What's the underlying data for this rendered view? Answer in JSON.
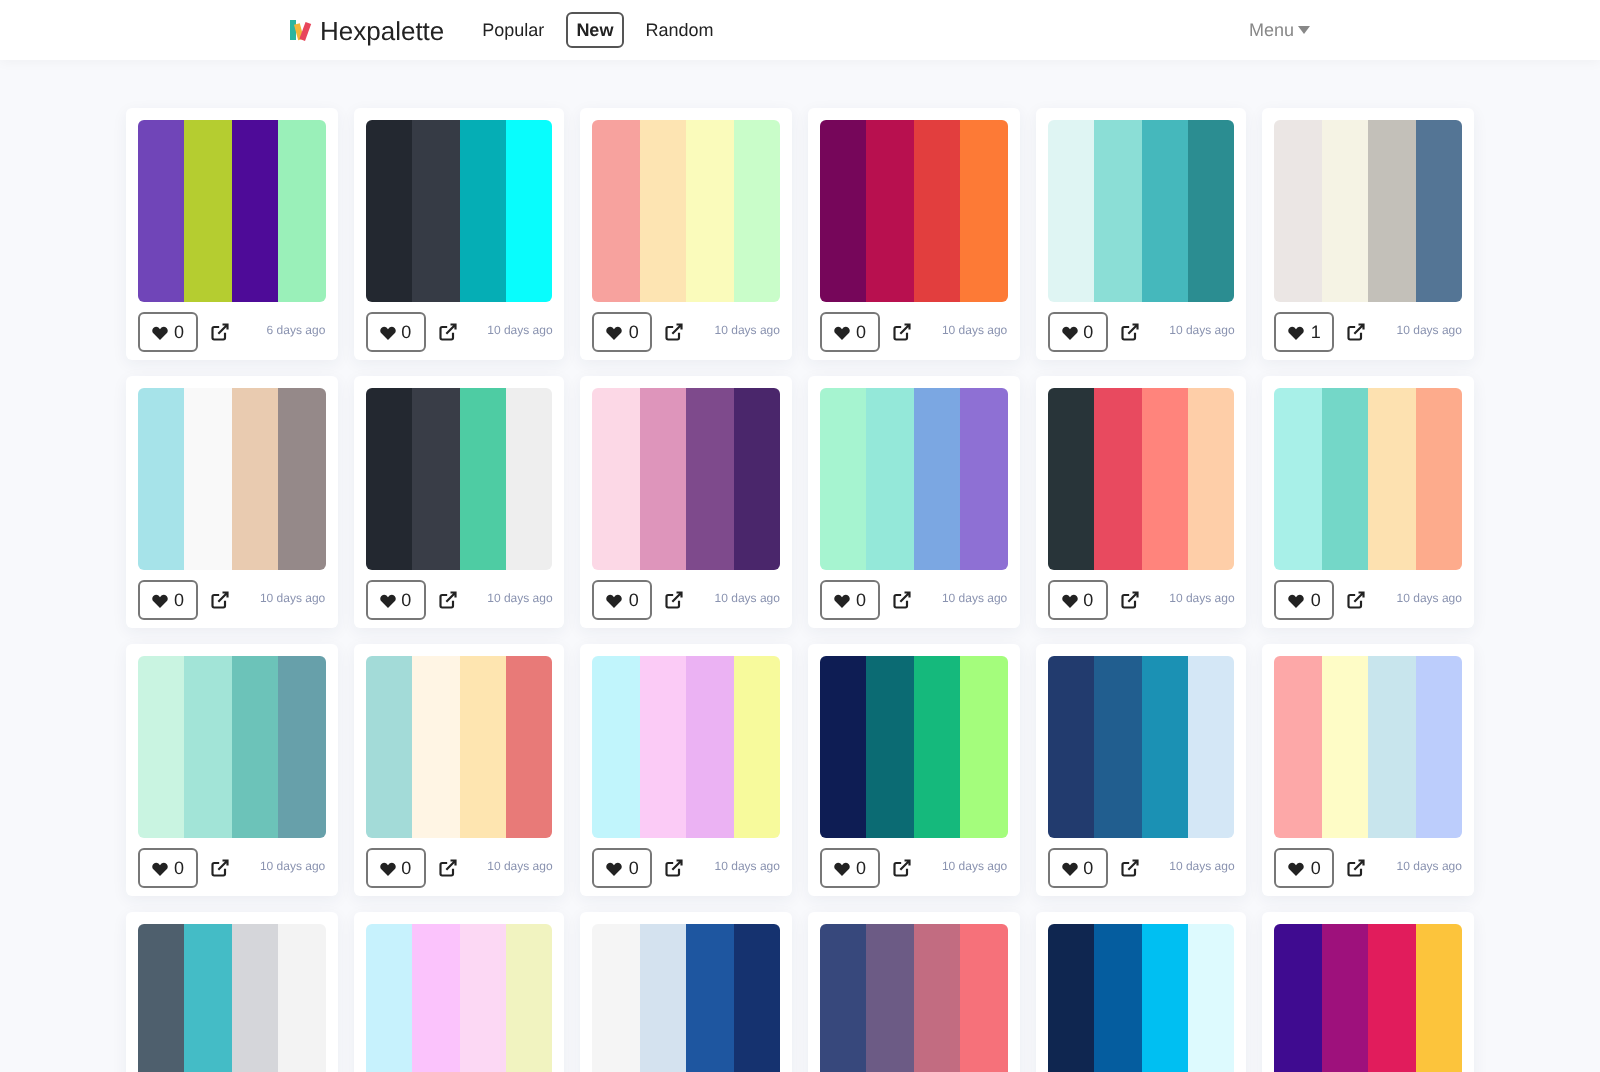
{
  "navbar": {
    "brand": "Hexpalette",
    "links": [
      {
        "label": "Popular",
        "selected": false
      },
      {
        "label": "New",
        "selected": true
      },
      {
        "label": "Random",
        "selected": false
      }
    ],
    "menu": "Menu"
  },
  "palettes": [
    {
      "stripes": [
        {
          "color": "#7045b8"
        },
        {
          "color": "#b5cd30"
        },
        {
          "color": "#4e0b98"
        },
        {
          "color": "#9af0b9"
        }
      ],
      "likes": "0",
      "age": "6 days ago"
    },
    {
      "stripes": [
        {
          "color": "#232830"
        },
        {
          "color": "#363b45"
        },
        {
          "color": "#05aeb5"
        },
        {
          "color": "#08fdfd"
        }
      ],
      "likes": "0",
      "age": "10 days ago"
    },
    {
      "stripes": [
        {
          "color": "#f7a29e"
        },
        {
          "color": "#fde4b2"
        },
        {
          "color": "#fafbbb"
        },
        {
          "color": "#c9fdc9"
        }
      ],
      "likes": "0",
      "age": "10 days ago"
    },
    {
      "stripes": [
        {
          "color": "#76065a"
        },
        {
          "color": "#b8104f"
        },
        {
          "color": "#e23e3e"
        },
        {
          "color": "#fd7a36"
        }
      ],
      "likes": "0",
      "age": "10 days ago"
    },
    {
      "stripes": [
        {
          "color": "#dff5f3"
        },
        {
          "color": "#8bded6"
        },
        {
          "color": "#45b8bc"
        },
        {
          "color": "#2b8d91"
        }
      ],
      "likes": "0",
      "age": "10 days ago"
    },
    {
      "stripes": [
        {
          "color": "#ebe6e4"
        },
        {
          "color": "#f5f3e4"
        },
        {
          "color": "#c3c0b9"
        },
        {
          "color": "#547595"
        }
      ],
      "likes": "1",
      "age": "10 days ago"
    },
    {
      "stripes": [
        {
          "color": "#a6e3e9"
        },
        {
          "color": "#f9f9f9"
        },
        {
          "color": "#e9cbb0"
        },
        {
          "color": "#958989"
        }
      ],
      "likes": "0",
      "age": "10 days ago"
    },
    {
      "stripes": [
        {
          "color": "#232830"
        },
        {
          "color": "#393d47"
        },
        {
          "color": "#4ecca3"
        },
        {
          "color": "#eeeeee"
        }
      ],
      "likes": "0",
      "age": "10 days ago"
    },
    {
      "stripes": [
        {
          "color": "#fcd8e6"
        },
        {
          "color": "#de95bb"
        },
        {
          "color": "#7e4a8c"
        },
        {
          "color": "#4a266b"
        }
      ],
      "likes": "0",
      "age": "10 days ago"
    },
    {
      "stripes": [
        {
          "color": "#a6f4d0"
        },
        {
          "color": "#94e8d9"
        },
        {
          "color": "#7ba7e2"
        },
        {
          "color": "#8e70d4"
        }
      ],
      "likes": "0",
      "age": "10 days ago"
    },
    {
      "stripes": [
        {
          "color": "#283439"
        },
        {
          "color": "#e84a5f"
        },
        {
          "color": "#ff847c"
        },
        {
          "color": "#fecea8"
        }
      ],
      "likes": "0",
      "age": "10 days ago"
    },
    {
      "stripes": [
        {
          "color": "#a8f0e8"
        },
        {
          "color": "#74d7c8"
        },
        {
          "color": "#fde1b0"
        },
        {
          "color": "#fdab8c"
        }
      ],
      "likes": "0",
      "age": "10 days ago"
    },
    {
      "stripes": [
        {
          "color": "#c9f4e1"
        },
        {
          "color": "#a2e4d7"
        },
        {
          "color": "#6cc3b9"
        },
        {
          "color": "#67a0aa"
        }
      ],
      "likes": "0",
      "age": "10 days ago"
    },
    {
      "stripes": [
        {
          "color": "#a3dbd8"
        },
        {
          "color": "#fff5e4"
        },
        {
          "color": "#fee5b0"
        },
        {
          "color": "#e87a78"
        }
      ],
      "likes": "0",
      "age": "10 days ago"
    },
    {
      "stripes": [
        {
          "color": "#c1f5fc"
        },
        {
          "color": "#fbcbf6"
        },
        {
          "color": "#ebb2f3"
        },
        {
          "color": "#f7fa9c"
        }
      ],
      "likes": "0",
      "age": "10 days ago"
    },
    {
      "stripes": [
        {
          "color": "#0e1d54"
        },
        {
          "color": "#0b6b73"
        },
        {
          "color": "#15b97c"
        },
        {
          "color": "#a4fd7c"
        }
      ],
      "likes": "0",
      "age": "10 days ago"
    },
    {
      "stripes": [
        {
          "color": "#223b6e"
        },
        {
          "color": "#215e8f"
        },
        {
          "color": "#1b91b4"
        },
        {
          "color": "#d4e7f6"
        }
      ],
      "likes": "0",
      "age": "10 days ago"
    },
    {
      "stripes": [
        {
          "color": "#fda8a8"
        },
        {
          "color": "#fefcc6"
        },
        {
          "color": "#c8e5ed"
        },
        {
          "color": "#bccdfc"
        }
      ],
      "likes": "0",
      "age": "10 days ago"
    },
    {
      "stripes": [
        {
          "color": "#4e5f6d"
        },
        {
          "color": "#44bcc6"
        },
        {
          "color": "#d5d6da"
        },
        {
          "color": "#f3f3f3"
        }
      ]
    },
    {
      "stripes": [
        {
          "color": "#c7f2fd"
        },
        {
          "color": "#fbc3fc"
        },
        {
          "color": "#fcd8f4"
        },
        {
          "color": "#f1f3c0"
        }
      ]
    },
    {
      "stripes": [
        {
          "color": "#f5f5f5"
        },
        {
          "color": "#d4e2ef"
        },
        {
          "color": "#1e56a0"
        },
        {
          "color": "#15326f"
        }
      ]
    },
    {
      "stripes": [
        {
          "color": "#37487c"
        },
        {
          "color": "#6c5b85"
        },
        {
          "color": "#c26c81"
        },
        {
          "color": "#f6717a"
        }
      ]
    },
    {
      "stripes": [
        {
          "color": "#0f2650"
        },
        {
          "color": "#055d9f"
        },
        {
          "color": "#00bff2"
        },
        {
          "color": "#ddfafe"
        }
      ]
    },
    {
      "stripes": [
        {
          "color": "#3f0b90"
        },
        {
          "color": "#9e117c"
        },
        {
          "color": "#e11c5c"
        },
        {
          "color": "#fcc43c"
        }
      ]
    }
  ]
}
